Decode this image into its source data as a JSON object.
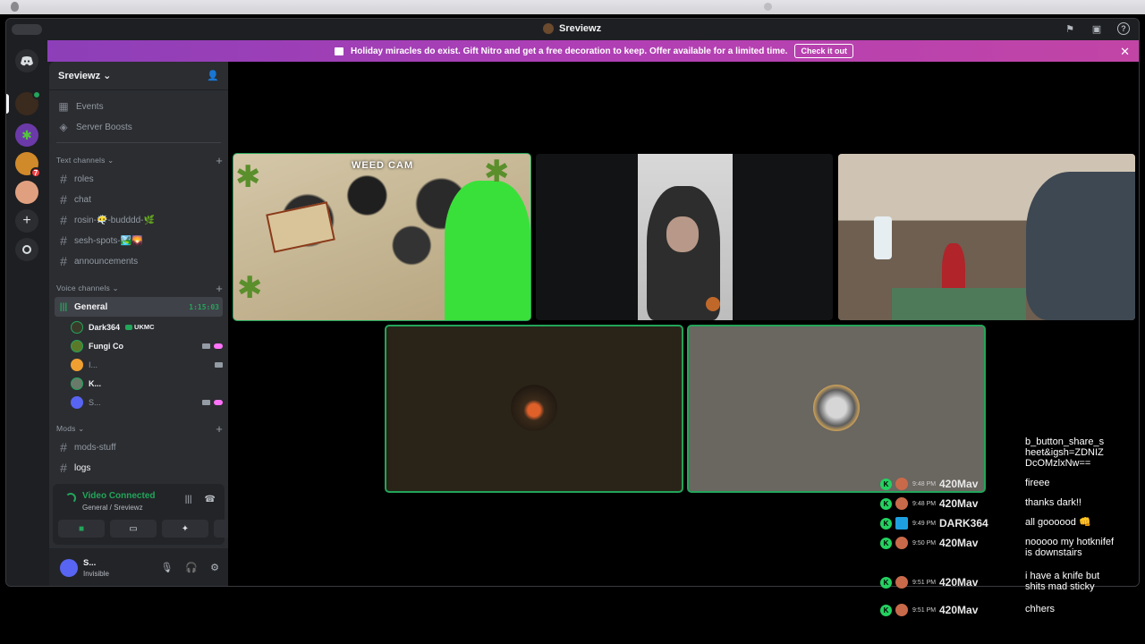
{
  "window": {
    "title": "Sreviewz"
  },
  "banner": {
    "text": "Holiday miracles do exist. Gift Nitro and get a free decoration to keep. Offer available for a limited time.",
    "button": "Check it out"
  },
  "rail": {
    "badge_count": "7"
  },
  "server": {
    "name": "Sreviewz",
    "nav": [
      {
        "label": "Events"
      },
      {
        "label": "Server Boosts"
      }
    ]
  },
  "text_category": "Text channels",
  "text_channels": [
    {
      "label": "roles"
    },
    {
      "label": "chat"
    },
    {
      "label": "rosin-😶‍🌫️-budddd-🌿"
    },
    {
      "label": "sesh-spots-🏞️🌄"
    },
    {
      "label": "announcements"
    }
  ],
  "voice_category": "Voice channels",
  "voice_channel": {
    "label": "General",
    "timer": "1:15:03"
  },
  "voice_users": [
    {
      "name": "Dark364",
      "tag": "UKMC"
    },
    {
      "name": "Fungi Co"
    },
    {
      "name": "I..."
    },
    {
      "name": "K..."
    },
    {
      "name": "S..."
    }
  ],
  "mods_category": "Mods",
  "mods_channels": [
    {
      "label": "mods-stuff"
    },
    {
      "label": "logs"
    }
  ],
  "voice_panel": {
    "status": "Video Connected",
    "location": "General / Sreviewz"
  },
  "user": {
    "name": "S...",
    "status": "Invisible"
  },
  "tiles": {
    "weed_cam_caption": "WEED CAM"
  },
  "chat_overlay": {
    "partial_prev": "b_button_share_s heet&igsh=ZDNIZ DcOMzlxNw==",
    "messages": [
      {
        "time": "9:48 PM",
        "user": "420Mav",
        "text": "fireee"
      },
      {
        "time": "9:48 PM",
        "user": "420Mav",
        "text": "thanks dark!!"
      },
      {
        "time": "9:49 PM",
        "user": "DARK364",
        "text": "all goooood 👊"
      },
      {
        "time": "9:50 PM",
        "user": "420Mav",
        "text": "nooooo my hotknifef is downstairs"
      },
      {
        "time": "9:51 PM",
        "user": "420Mav",
        "text": "i have a knife but shits mad sticky"
      },
      {
        "time": "9:51 PM",
        "user": "420Mav",
        "text": "chhers"
      }
    ]
  },
  "colors": {
    "accent_green": "#23a55a",
    "banner_purple": "#a040b8",
    "sidebar_bg": "#2b2d31"
  }
}
